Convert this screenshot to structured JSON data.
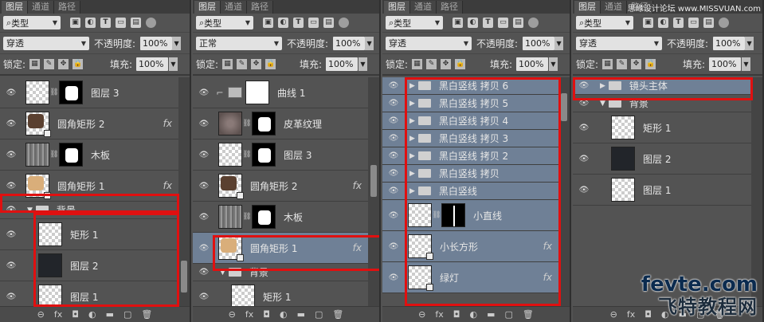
{
  "tabs": [
    "图层",
    "通道",
    "路径"
  ],
  "filter_label": "类型",
  "lock_label": "锁定:",
  "fill_label": "填充:",
  "opacity_label": "不透明度:",
  "icons": [
    "image-filter-icon",
    "adjust-filter-icon",
    "text-filter-icon",
    "shape-filter-icon",
    "smart-filter-icon",
    "filter-toggle-icon"
  ],
  "panels": [
    {
      "blend": "穿透",
      "opacity": "100%",
      "fill": "100%",
      "layers": [
        {
          "name": "图层 3",
          "kind": "mask-partial"
        },
        {
          "name": "圆角矩形 2",
          "kind": "shape-dark",
          "fx": "fx"
        },
        {
          "name": "木板",
          "kind": "wood-mask"
        },
        {
          "name": "圆角矩形 1",
          "kind": "shape-tan",
          "fx": "fx"
        },
        {
          "name": "背景",
          "kind": "group-open"
        },
        {
          "name": "矩形 1",
          "kind": "checker",
          "indent": true
        },
        {
          "name": "图层 2",
          "kind": "dark",
          "indent": true
        },
        {
          "name": "图层 1",
          "kind": "checker",
          "indent": true
        }
      ]
    },
    {
      "blend": "正常",
      "opacity": "100%",
      "fill": "100%",
      "layers": [
        {
          "name": "曲线 1",
          "kind": "curves"
        },
        {
          "name": "皮革纹理",
          "kind": "leather-mask"
        },
        {
          "name": "图层 3",
          "kind": "checker-mask"
        },
        {
          "name": "圆角矩形 2",
          "kind": "shape-dark",
          "fx": "fx"
        },
        {
          "name": "木板",
          "kind": "wood-mask"
        },
        {
          "name": "圆角矩形 1",
          "kind": "shape-tan",
          "fx": "fx",
          "selected": true
        },
        {
          "name": "背景",
          "kind": "group-open"
        },
        {
          "name": "矩形 1",
          "kind": "checker-partial",
          "indent": true
        }
      ]
    },
    {
      "blend": "穿透",
      "opacity": "100%",
      "fill": "100%",
      "layers": [
        {
          "name": "黑白竖线 拷贝 6",
          "kind": "group",
          "selected": true
        },
        {
          "name": "黑白竖线 拷贝 5",
          "kind": "group",
          "selected": true
        },
        {
          "name": "黑白竖线 拷贝 4",
          "kind": "group",
          "selected": true
        },
        {
          "name": "黑白竖线 拷贝 3",
          "kind": "group",
          "selected": true
        },
        {
          "name": "黑白竖线 拷贝 2",
          "kind": "group",
          "selected": true
        },
        {
          "name": "黑白竖线 拷贝",
          "kind": "group",
          "selected": true
        },
        {
          "name": "黑白竖线",
          "kind": "group",
          "selected": true
        },
        {
          "name": "小直线",
          "kind": "line-mask",
          "selected": true
        },
        {
          "name": "小长方形",
          "kind": "shape-checker",
          "fx": "fx",
          "selected": true
        },
        {
          "name": "绿灯",
          "kind": "shape-checker",
          "fx": "fx",
          "selected": true
        }
      ]
    },
    {
      "blend": "穿透",
      "opacity": "100%",
      "fill": "100%",
      "layers": [
        {
          "name": "镜头主体",
          "kind": "group",
          "selected": true
        },
        {
          "name": "背景",
          "kind": "group-open"
        },
        {
          "name": "矩形 1",
          "kind": "checker",
          "indent": true
        },
        {
          "name": "图层 2",
          "kind": "dark",
          "indent": true
        },
        {
          "name": "图层 1",
          "kind": "checker",
          "indent": true
        }
      ]
    }
  ],
  "footer_icons": [
    "link-icon",
    "fx-icon",
    "mask-icon",
    "adjustment-icon",
    "folder-icon",
    "new-layer-icon",
    "trash-icon"
  ],
  "footer_glyphs": [
    "⊖",
    "fx",
    "◘",
    "◐",
    "▬",
    "▢",
    "🗑"
  ],
  "watermark_top": "思缘设计论坛 www.MISSVUAN.com",
  "watermark_brand": "fevte.com",
  "watermark_cn": "飞特教程网",
  "colors": {
    "panel_bg": "#535353",
    "selected": "#6f8096",
    "highlight_border": "#e01010"
  }
}
